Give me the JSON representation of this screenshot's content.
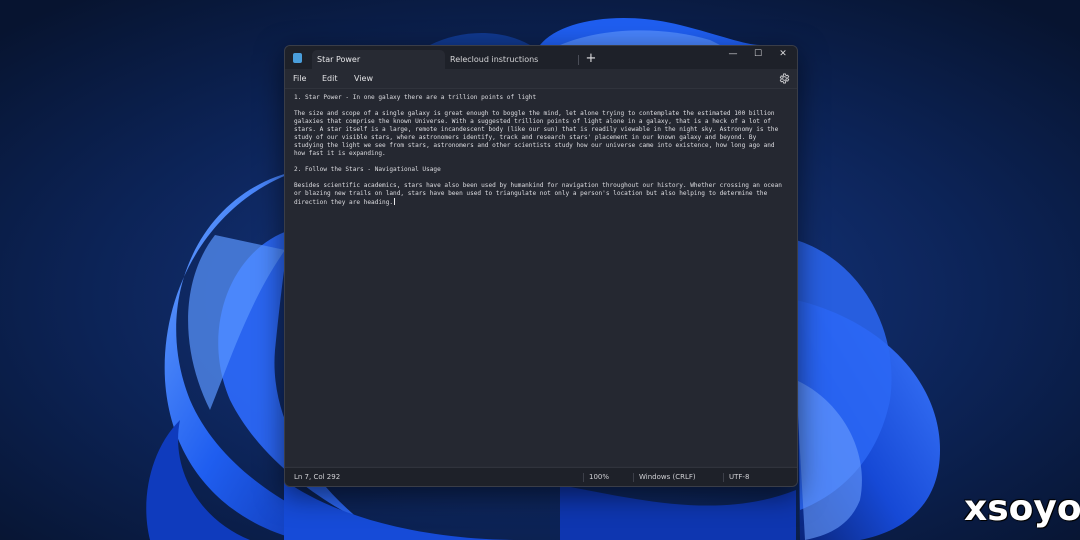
{
  "app": {
    "tabs": [
      {
        "label": "Star Power",
        "active": true
      },
      {
        "label": "Relecloud instructions",
        "active": false
      }
    ],
    "new_tab_symbol": "+",
    "window_controls": {
      "minimize": "—",
      "maximize": "☐",
      "close": "✕"
    }
  },
  "menu": {
    "items": [
      "File",
      "Edit",
      "View"
    ],
    "settings_icon": "gear-icon"
  },
  "document": {
    "paragraphs": [
      "1. Star Power - In one galaxy there are a trillion points of light",
      "The size and scope of a single galaxy is great enough to boggle the mind, let alone trying to contemplate the estimated 100 billion galaxies that comprise the known Universe. With a suggested trillion points of light alone in a galaxy, that is a heck of a lot of stars. A star itself is a large, remote incandescent body (like our sun) that is readily viewable in the night sky. Astronomy is the study of our visible stars, where astronomers identify, track and research stars' placement in our known galaxy and beyond. By studying the light we see from stars, astronomers and other scientists study how our universe came into existence, how long ago and how fast it is expanding.",
      "2. Follow the Stars - Navigational Usage",
      "Besides scientific academics, stars have also been used by humankind for navigation throughout our history. Whether crossing an ocean or blazing new trails on land, stars have been used to triangulate not only a person's location but also helping to determine the direction they are heading."
    ]
  },
  "status": {
    "position": "Ln 7, Col 292",
    "zoom": "100%",
    "line_ending": "Windows (CRLF)",
    "encoding": "UTF-8"
  },
  "watermark": {
    "text": "xsoyo"
  },
  "colors": {
    "accent": "#4a9edb",
    "window_bg": "#272a33",
    "titlebar_bg": "#1e2129",
    "wallpaper_bg": "#0a1a3c",
    "bloom_blue": "#1f5ef0"
  }
}
